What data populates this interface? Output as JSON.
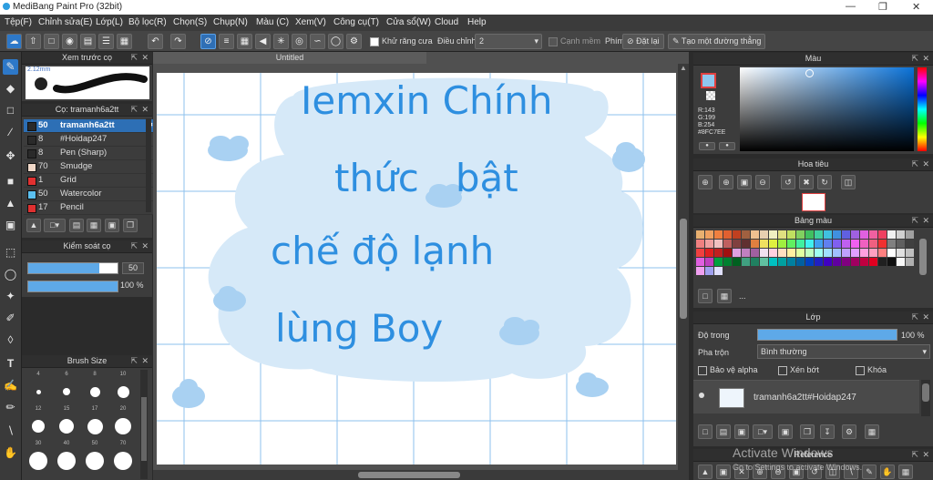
{
  "window": {
    "title": "MediBang Paint Pro (32bit)"
  },
  "menu": [
    "Tệp(F)",
    "Chỉnh sửa(E)",
    "Lớp(L)",
    "Bộ lọc(R)",
    "Chọn(S)",
    "Chụp(N)",
    "Màu (C)",
    "Xem(V)",
    "Công cụ(T)",
    "Cửa sổ(W)",
    "Cloud",
    "Help"
  ],
  "toolbar": {
    "antialias_label": "Khử răng cưa",
    "correction_label": "Điều chỉnh",
    "correction_value": "2",
    "edge_label": "Cạnh mềm",
    "phim_label": "Phím",
    "reset_label": "Đặt lại",
    "straight_label": "Tạo một đường thẳng"
  },
  "brush_preview": {
    "title": "Xem trước cọ",
    "size_text": "2.12mm"
  },
  "brush_list": {
    "title": "Cọ: tramanh6a2tt",
    "items": [
      {
        "size": "50",
        "name": "tramanh6a2tt",
        "color": "#2a2a2a"
      },
      {
        "size": "8",
        "name": "#Hoidap247",
        "color": "#2a2a2a"
      },
      {
        "size": "8",
        "name": "Pen (Sharp)",
        "color": "#2a2a2a"
      },
      {
        "size": "70",
        "name": "Smudge",
        "color": "#f0d8c8"
      },
      {
        "size": "1",
        "name": "Grid",
        "color": "#e03030"
      },
      {
        "size": "50",
        "name": "Watercolor",
        "color": "#5bc0f0"
      },
      {
        "size": "17",
        "name": "Pencil",
        "color": "#e03030"
      }
    ]
  },
  "brush_control": {
    "title": "Kiểm soát cọ",
    "size_value": "50",
    "opacity_value": "100 %",
    "size_fraction": 0.8,
    "opacity_fraction": 1.0
  },
  "brush_size": {
    "title": "Brush Size",
    "rows": [
      [
        "4",
        "6",
        "8",
        "10"
      ],
      [
        "12",
        "15",
        "17",
        "20"
      ],
      [
        "30",
        "40",
        "50",
        "70"
      ]
    ]
  },
  "canvas": {
    "tab": "Untitled",
    "text_lines": [
      "Iemxin Chính",
      "thức   bật",
      "chế độ lạnh",
      "lùng Boy"
    ]
  },
  "color_panel": {
    "title": "Màu",
    "r": "R:143",
    "g": "G:199",
    "b": "B:254",
    "hex": "#8FC7EE",
    "current": "#8fc7ee"
  },
  "navigator": {
    "title": "Hoa tiêu"
  },
  "palette": {
    "title": "Bảng màu",
    "more": "...",
    "colors": [
      "#e8b070",
      "#f0a060",
      "#f08040",
      "#e06030",
      "#c04020",
      "#a06040",
      "#f0c090",
      "#e8d0b0",
      "#f0f0c0",
      "#e0e080",
      "#c0e060",
      "#80d060",
      "#40c060",
      "#40d0a0",
      "#40c0e0",
      "#4090e0",
      "#6060e0",
      "#a060e0",
      "#e060e0",
      "#f060a0",
      "#f04060",
      "#f0f0f0",
      "#d0d0d0",
      "#a0a0a0",
      "#f08080",
      "#f0a0a0",
      "#f0c0c0",
      "#c06060",
      "#804040",
      "#603030",
      "#e08040",
      "#f0e060",
      "#e0f040",
      "#a0f040",
      "#60f060",
      "#40f0a0",
      "#40f0f0",
      "#40a0f0",
      "#6080f0",
      "#8060f0",
      "#c060f0",
      "#f060f0",
      "#f060c0",
      "#f06080",
      "#f03030",
      "#808080",
      "#606060",
      "#404040",
      "#f04040",
      "#e02020",
      "#c02020",
      "#a01010",
      "#e0a0e0",
      "#c080c0",
      "#a060a0",
      "#f0e0f0",
      "#ffd0e0",
      "#ffe0c0",
      "#fff0a0",
      "#e0ffa0",
      "#c0ffc0",
      "#a0fff0",
      "#a0e0ff",
      "#a0c0ff",
      "#c0a0ff",
      "#e0a0ff",
      "#ffa0e0",
      "#ffa0c0",
      "#ff8080",
      "#ffffff",
      "#e0e0e0",
      "#c0c0c0",
      "#e060e0",
      "#c040c0",
      "#00a040",
      "#008030",
      "#006020",
      "#40a080",
      "#208060",
      "#60c0a0",
      "#00c0c0",
      "#00a0a0",
      "#0080a0",
      "#0060a0",
      "#0040c0",
      "#2020c0",
      "#4000c0",
      "#6000a0",
      "#800080",
      "#a00060",
      "#c00040",
      "#e00020",
      "#202020",
      "#101010",
      "#f8f8f8",
      "#b0b0b0",
      "#f0a0f0",
      "#a0a0f0",
      "#e0e0ff"
    ]
  },
  "layer_panel": {
    "title": "Lớp",
    "opacity_label": "Độ trong",
    "opacity_value": "100 %",
    "opacity_fraction": 1.0,
    "blend_label": "Pha trộn",
    "blend_value": "Bình thường",
    "protect_alpha": "Bảo vệ alpha",
    "clipping": "Xén bớt",
    "lock": "Khóa",
    "layer_name": "tramanh6a2tt#Hoidap247"
  },
  "reference": {
    "title": "Reference"
  },
  "watermark": {
    "line1": "Activate Windows",
    "line2": "Go to Settings to activate Windows."
  }
}
